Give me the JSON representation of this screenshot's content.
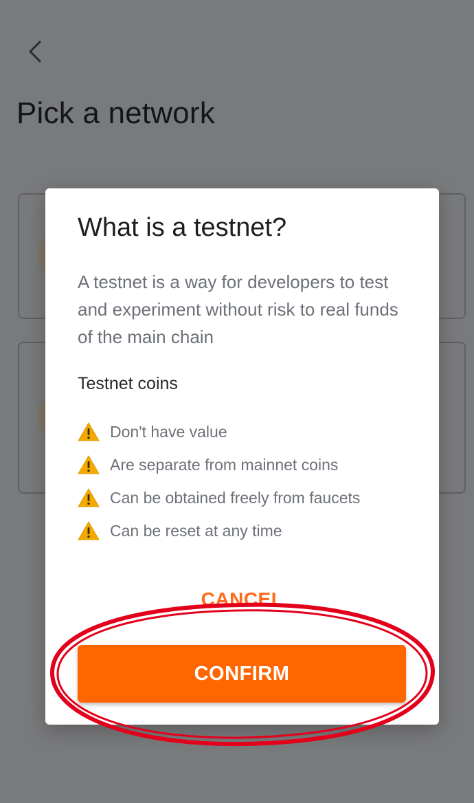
{
  "page": {
    "title": "Pick a network",
    "back_icon": "chevron-left-icon"
  },
  "modal": {
    "title": "What is a testnet?",
    "description": "A testnet is a way for developers to test and experiment without risk to real funds of the main chain",
    "section_title": "Testnet coins",
    "warning_icon": "warning-triangle-icon",
    "warnings": [
      "Don't have value",
      "Are separate from mainnet coins",
      "Can be obtained freely from faucets",
      "Can be reset at any time"
    ],
    "cancel_label": "CANCEL",
    "confirm_label": "CONFIRM"
  },
  "colors": {
    "accent": "#ff6600",
    "annotation": "#e3001b",
    "overlay": "#797a7c",
    "warning": "#f2a900"
  }
}
